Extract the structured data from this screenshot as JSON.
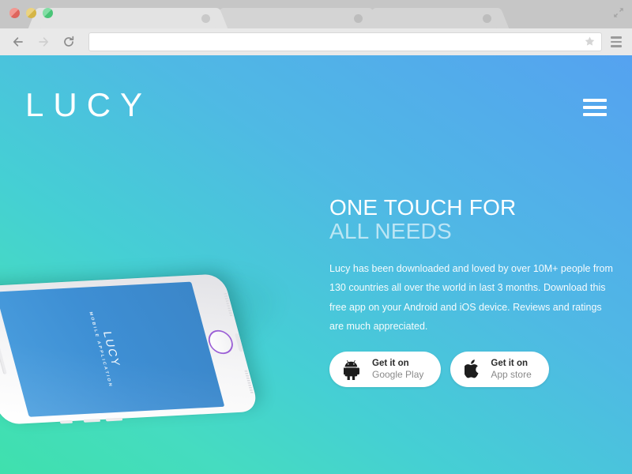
{
  "browser": {
    "window_controls": [
      {
        "name": "close",
        "color": "#ec6b63"
      },
      {
        "name": "minimize",
        "color": "#e2c04a"
      },
      {
        "name": "maximize",
        "color": "#4ed07e"
      }
    ],
    "tabs": [
      {
        "label": ""
      },
      {
        "label": ""
      },
      {
        "label": ""
      }
    ],
    "toolbar": {
      "back_label": "Back",
      "forward_label": "Forward",
      "reload_label": "Reload",
      "url_value": "",
      "url_placeholder": "",
      "bookmark_label": "Bookmark",
      "menu_label": "Menu"
    },
    "resize_label": "Resize"
  },
  "page": {
    "logo": "LUCY",
    "nav_toggle_label": "Menu",
    "hero": {
      "headline_line1": "ONE TOUCH FOR",
      "headline_line2": "ALL NEEDS",
      "paragraph": "Lucy has been downloaded and loved by over 10M+ people from 130 countries all over the world in last 3 months. Download this free app on your Android and iOS device. Reviews and ratings are much appreciated.",
      "buttons": [
        {
          "icon": "android-icon",
          "top": "Get it on",
          "bottom": "Google Play"
        },
        {
          "icon": "apple-icon",
          "top": "Get it on",
          "bottom": "App store"
        }
      ]
    },
    "phone": {
      "screen_brand": "LUCY",
      "screen_tagline": "MOBILE APPLICATION"
    },
    "colors": {
      "gradient_start": "#3fe0ad",
      "gradient_end": "#55a2f0",
      "screen_blue": "#3e8fd4",
      "home_button_ring": "#9b5fd6"
    }
  }
}
